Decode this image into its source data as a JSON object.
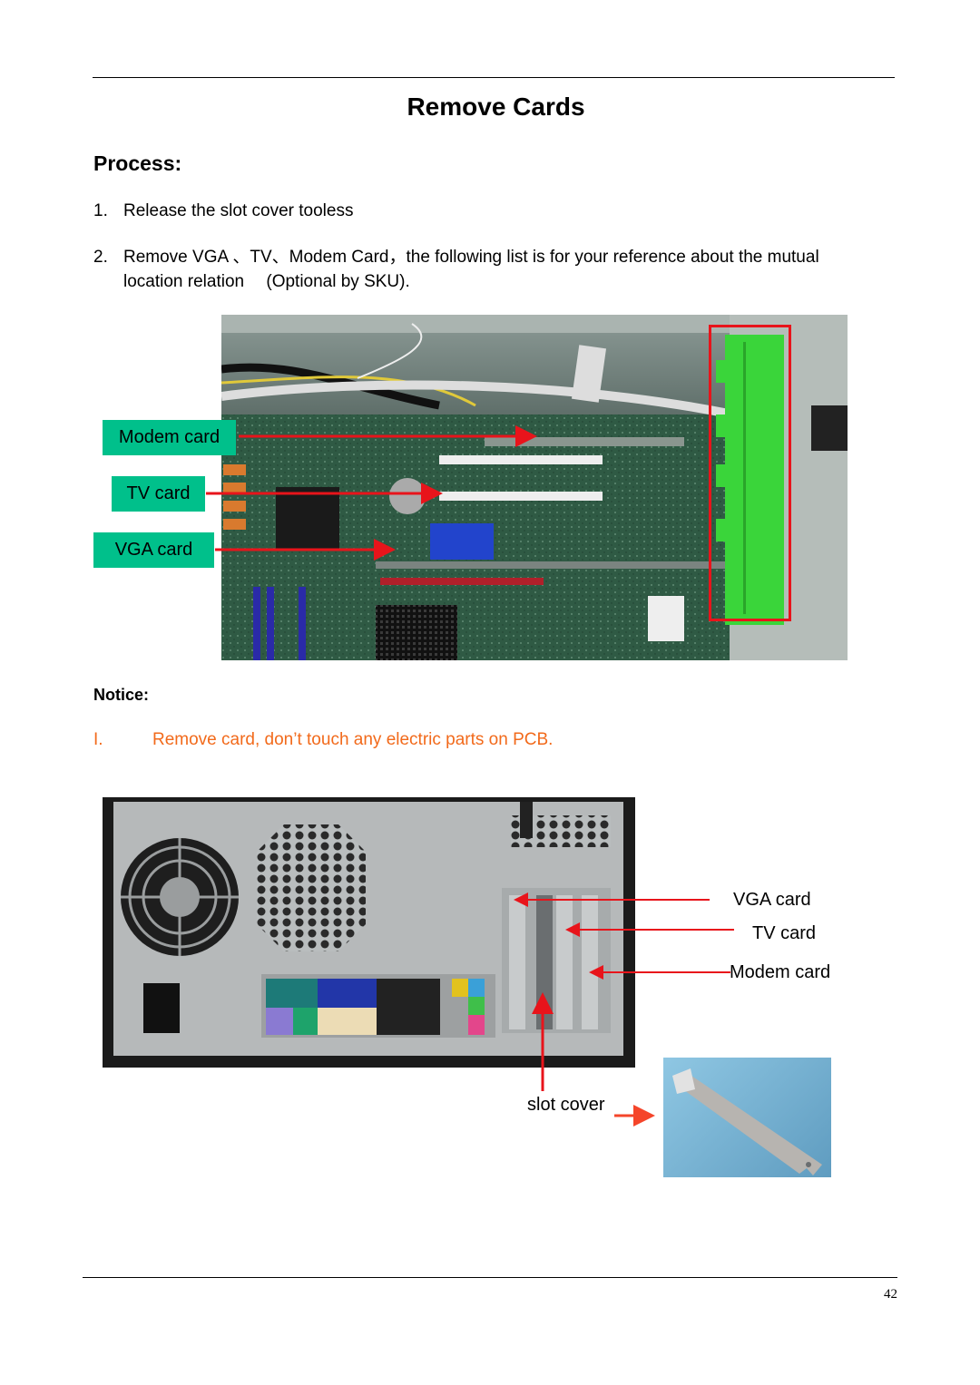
{
  "page": {
    "title": "Remove Cards",
    "section_heading": "Process:",
    "steps": [
      {
        "num": "1.",
        "text": "Release the slot cover tooless"
      },
      {
        "num": "2.",
        "text_line1": "Remove VGA 、TV、Modem Card，the following list is for your reference about the mutual",
        "text_line2": "location relation 　(Optional by SKU)."
      }
    ],
    "notice_heading": "Notice:",
    "notices": [
      {
        "num": "I.",
        "text": "Remove card, don’t touch any electric parts on PCB."
      }
    ],
    "page_number": "42"
  },
  "figure1": {
    "description": "motherboard-interior-photo",
    "callouts": [
      "Modem card",
      "TV card",
      "VGA card"
    ],
    "highlight_color": "#e8141b",
    "label_bg": "#00c08b"
  },
  "figure2": {
    "description": "chassis-rear-photo",
    "callouts": [
      "VGA card",
      "TV card",
      "Modem card"
    ],
    "slot_cover_label": "slot cover"
  },
  "colors": {
    "accent_orange": "#f26a1b",
    "arrow_red": "#e8141b"
  }
}
